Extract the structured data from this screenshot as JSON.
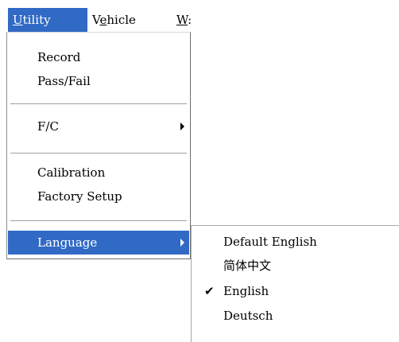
{
  "menubar": {
    "items": [
      {
        "mnemonic": "U",
        "rest": "tility"
      },
      {
        "prefix": "V",
        "mnemonic": "e",
        "rest": "hicle"
      },
      {
        "mnemonic": "W",
        "rest": ":"
      }
    ]
  },
  "utility_menu": {
    "record": "Record",
    "pass_fail": "Pass/Fail",
    "fc": "F/C",
    "calibration": "Calibration",
    "factory_setup": "Factory Setup",
    "language": "Language"
  },
  "language_submenu": {
    "items": [
      {
        "label": "Default English",
        "checked": false
      },
      {
        "label": "简体中文",
        "checked": false
      },
      {
        "label": "English",
        "checked": true
      },
      {
        "label": "Deutsch",
        "checked": false
      }
    ],
    "check_glyph": "✔"
  },
  "colors": {
    "highlight": "#316ac5",
    "highlight_text": "#ffffff"
  },
  "icons": {
    "submenu_arrow": "triangle-right-icon",
    "checkmark": "check-icon"
  }
}
